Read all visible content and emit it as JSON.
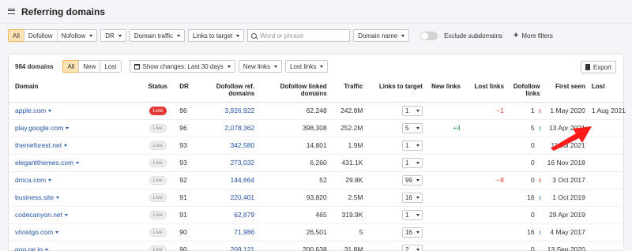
{
  "page": {
    "title": "Referring domains"
  },
  "filters": {
    "mode": [
      "All",
      "Dofollow",
      "Nofollow"
    ],
    "dr_label": "DR",
    "domain_traffic_label": "Domain traffic",
    "links_to_target_label": "Links to target",
    "search_placeholder": "Word or phrase",
    "search_scope": "Domain name",
    "exclude_subdomains_label": "Exclude subdomains",
    "more_filters_label": "More filters"
  },
  "toolbar": {
    "count": "984 domains",
    "tabs": [
      "All",
      "New",
      "Lost"
    ],
    "show_changes": "Show changes: Last 30 days",
    "new_links": "New links",
    "lost_links": "Lost links",
    "export": "Export"
  },
  "table": {
    "headers": [
      "Domain",
      "Status",
      "DR",
      "Dofollow ref. domains",
      "Dofollow linked domains",
      "Traffic",
      "Links to target",
      "New links",
      "Lost links",
      "Dofollow links",
      "First seen",
      "Lost"
    ],
    "rows": [
      {
        "domain": "apple.com",
        "status": "Lost",
        "dr": "96",
        "ref": "3,926,922",
        "linked": "62,248",
        "traffic": "242.8M",
        "links": "1",
        "new": "",
        "lost": "−1",
        "dofollow": "1",
        "first": "1 May 2020",
        "lost_date": "1 Aug 2021"
      },
      {
        "domain": "play.google.com",
        "status": "Live",
        "dr": "96",
        "ref": "2,078,362",
        "linked": "398,308",
        "traffic": "252.2M",
        "links": "5",
        "new": "+4",
        "lost": "",
        "dofollow": "5",
        "first": "13 Apr 2021",
        "lost_date": ""
      },
      {
        "domain": "themeforest.net",
        "status": "Live",
        "dr": "93",
        "ref": "342,580",
        "linked": "14,801",
        "traffic": "1.9M",
        "links": "1",
        "new": "",
        "lost": "",
        "dofollow": "0",
        "first": "11 Jul 2021",
        "lost_date": ""
      },
      {
        "domain": "elegantthemes.com",
        "status": "Live",
        "dr": "93",
        "ref": "273,032",
        "linked": "6,260",
        "traffic": "431.1K",
        "links": "1",
        "new": "",
        "lost": "",
        "dofollow": "0",
        "first": "16 Nov 2018",
        "lost_date": ""
      },
      {
        "domain": "dmca.com",
        "status": "Live",
        "dr": "92",
        "ref": "144,664",
        "linked": "52",
        "traffic": "29.8K",
        "links": "99",
        "new": "",
        "lost": "−8",
        "dofollow": "0",
        "first": "3 Oct 2017",
        "lost_date": ""
      },
      {
        "domain": "business.site",
        "status": "Live",
        "dr": "91",
        "ref": "220,401",
        "linked": "93,820",
        "traffic": "2.5M",
        "links": "16",
        "new": "",
        "lost": "",
        "dofollow": "16",
        "first": "1 Oct 2019",
        "lost_date": ""
      },
      {
        "domain": "codecanyon.net",
        "status": "Live",
        "dr": "91",
        "ref": "62,879",
        "linked": "465",
        "traffic": "319.9K",
        "links": "1",
        "new": "",
        "lost": "",
        "dofollow": "0",
        "first": "29 Apr 2019",
        "lost_date": ""
      },
      {
        "domain": "vhostgo.com",
        "status": "Live",
        "dr": "90",
        "ref": "71,986",
        "linked": "26,501",
        "traffic": "5",
        "links": "16",
        "new": "",
        "lost": "",
        "dofollow": "16",
        "first": "4 May 2017",
        "lost_date": ""
      },
      {
        "domain": "goo.ne.jp",
        "status": "Live",
        "dr": "90",
        "ref": "209,121",
        "linked": "200,638",
        "traffic": "31.8M",
        "links": "2",
        "new": "",
        "lost": "",
        "dofollow": "0",
        "first": "13 Sep 2020",
        "lost_date": ""
      }
    ]
  },
  "colors": {
    "accent": "#ffe3b3",
    "link": "#2255aa",
    "lost": "#e53935",
    "arrow": "#ff1a1a"
  }
}
